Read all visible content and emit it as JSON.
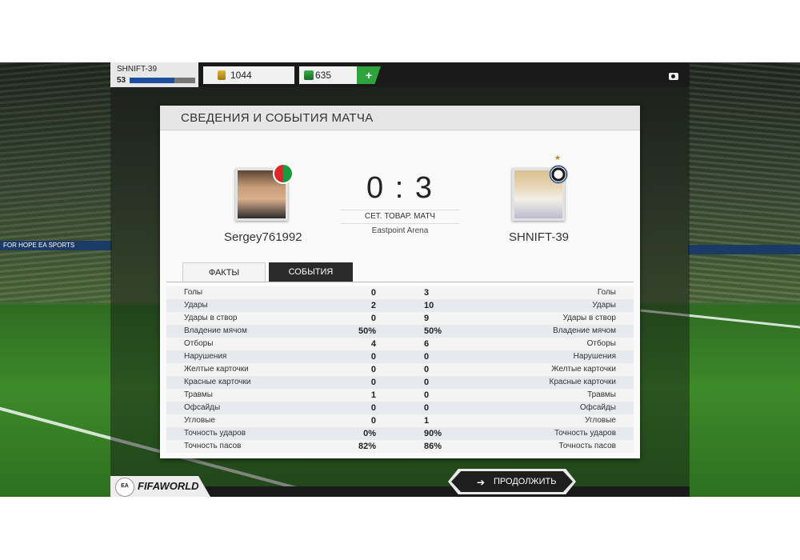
{
  "topbar": {
    "player_name": "SHNIFT-39",
    "player_level": "53",
    "xp_fraction": 0.68,
    "coins": "1044",
    "points": "635",
    "add_label": "+",
    "accent": "#2fa33c"
  },
  "panel": {
    "title": "СВЕДЕНИЯ И СОБЫТИЯ МАТЧА"
  },
  "match": {
    "home_team": "Sergey761992",
    "away_team": "SHNIFT-39",
    "score": "0 : 3",
    "match_type": "СЕТ. ТОВАР. МАТЧ",
    "arena": "Eastpoint Arena"
  },
  "tabs": {
    "facts": "ФАКТЫ",
    "events": "СОБЫТИЯ"
  },
  "stats": [
    {
      "label": "Голы",
      "home": "0",
      "away": "3"
    },
    {
      "label": "Удары",
      "home": "2",
      "away": "10"
    },
    {
      "label": "Удары в створ",
      "home": "0",
      "away": "9"
    },
    {
      "label": "Владение мячом",
      "home": "50%",
      "away": "50%"
    },
    {
      "label": "Отборы",
      "home": "4",
      "away": "6"
    },
    {
      "label": "Нарушения",
      "home": "0",
      "away": "0"
    },
    {
      "label": "Желтые карточки",
      "home": "0",
      "away": "0"
    },
    {
      "label": "Красные карточки",
      "home": "0",
      "away": "0"
    },
    {
      "label": "Травмы",
      "home": "1",
      "away": "0"
    },
    {
      "label": "Офсайды",
      "home": "0",
      "away": "0"
    },
    {
      "label": "Угловые",
      "home": "0",
      "away": "1"
    },
    {
      "label": "Точность ударов",
      "home": "0%",
      "away": "90%"
    },
    {
      "label": "Точность пасов",
      "home": "82%",
      "away": "86%"
    }
  ],
  "footer": {
    "ea_logo": "EA SPORTS",
    "fifa_logo": "FIFAWORLD",
    "continue_label": "ПРОДОЛЖИТЬ",
    "continue_icon": "arrow-right-icon"
  },
  "background": {
    "adboard_text": "FOR HOPE  EA SPORTS"
  }
}
